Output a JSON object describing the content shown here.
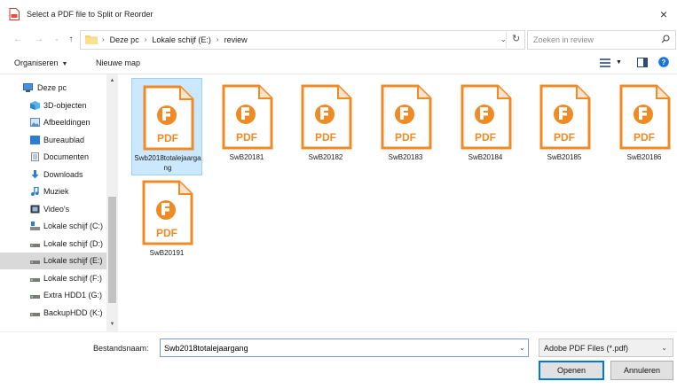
{
  "window": {
    "title": "Select a PDF file to Split or Reorder",
    "close_glyph": "×"
  },
  "address_bar": {
    "crumbs": [
      "Deze pc",
      "Lokale schijf (E:)",
      "review"
    ],
    "separator": "›",
    "search_placeholder": "Zoeken in review"
  },
  "toolbar": {
    "organize_label": "Organiseren",
    "new_folder_label": "Nieuwe map"
  },
  "sidebar": {
    "items": [
      {
        "label": "Deze pc",
        "icon": "computer-icon"
      },
      {
        "label": "3D-objecten",
        "icon": "cube-icon"
      },
      {
        "label": "Afbeeldingen",
        "icon": "pictures-icon"
      },
      {
        "label": "Bureaublad",
        "icon": "desktop-icon"
      },
      {
        "label": "Documenten",
        "icon": "documents-icon"
      },
      {
        "label": "Downloads",
        "icon": "download-icon"
      },
      {
        "label": "Muziek",
        "icon": "music-icon"
      },
      {
        "label": "Video's",
        "icon": "video-icon"
      },
      {
        "label": "Lokale schijf (C:)",
        "icon": "system-drive-icon"
      },
      {
        "label": "Lokale schijf (D:)",
        "icon": "drive-icon"
      },
      {
        "label": "Lokale schijf (E:)",
        "icon": "drive-icon",
        "selected": true
      },
      {
        "label": "Lokale schijf (F:)",
        "icon": "drive-icon"
      },
      {
        "label": "Extra HDD1 (G:)",
        "icon": "drive-icon"
      },
      {
        "label": "BackupHDD (K:)",
        "icon": "drive-icon"
      }
    ]
  },
  "files": {
    "pdf_badge": "PDF",
    "items": [
      {
        "name": "Swb2018totalejaargang",
        "selected": true
      },
      {
        "name": "SwB20181"
      },
      {
        "name": "SwB20182"
      },
      {
        "name": "SwB20183"
      },
      {
        "name": "SwB20184"
      },
      {
        "name": "SwB20185"
      },
      {
        "name": "SwB20186"
      },
      {
        "name": "SwB20191"
      }
    ]
  },
  "bottom": {
    "filename_label": "Bestandsnaam:",
    "filename_value": "Swb2018totalejaargang",
    "filetype_value": "Adobe PDF Files (*.pdf)",
    "open_label": "Openen",
    "cancel_label": "Annuleren"
  },
  "colors": {
    "pdf_orange": "#f08a24",
    "selection_bg": "#cce8ff",
    "accent_blue": "#0078d7"
  }
}
